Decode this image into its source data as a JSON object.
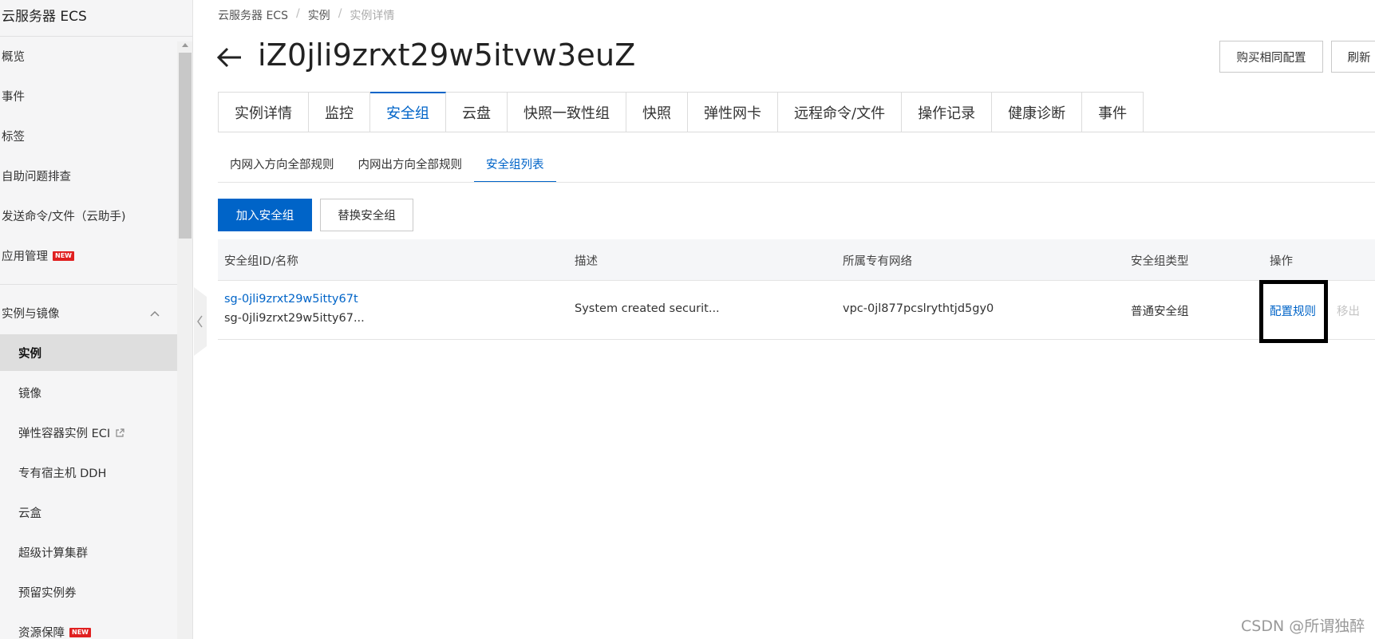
{
  "sidebar": {
    "title": "云服务器 ECS",
    "items": [
      {
        "label": "概览"
      },
      {
        "label": "事件"
      },
      {
        "label": "标签"
      },
      {
        "label": "自助问题排查"
      },
      {
        "label": "发送命令/文件（云助手)"
      },
      {
        "label": "应用管理",
        "badge": "NEW"
      }
    ],
    "group": {
      "label": "实例与镜像",
      "icon": "chevron-up-icon"
    },
    "sub_items": [
      {
        "label": "实例",
        "active": true
      },
      {
        "label": "镜像"
      },
      {
        "label": "弹性容器实例 ECI",
        "icon": "external-link-icon"
      },
      {
        "label": "专有宿主机 DDH"
      },
      {
        "label": "云盒"
      },
      {
        "label": "超级计算集群"
      },
      {
        "label": "预留实例券"
      },
      {
        "label": "资源保障",
        "badge": "NEW"
      }
    ]
  },
  "breadcrumb": [
    "云服务器 ECS",
    "实例",
    "实例详情"
  ],
  "header": {
    "title": "iZ0jli9zrxt29w5itvw3euZ",
    "buy_same_label": "购买相同配置",
    "refresh_label": "刷新"
  },
  "tabs": [
    "实例详情",
    "监控",
    "安全组",
    "云盘",
    "快照一致性组",
    "快照",
    "弹性网卡",
    "远程命令/文件",
    "操作记录",
    "健康诊断",
    "事件"
  ],
  "active_tab": "安全组",
  "subtabs": [
    "内网入方向全部规则",
    "内网出方向全部规则",
    "安全组列表"
  ],
  "active_subtab": "安全组列表",
  "actions": {
    "join_label": "加入安全组",
    "replace_label": "替换安全组"
  },
  "table": {
    "columns": [
      "安全组ID/名称",
      "描述",
      "所属专有网络",
      "安全组类型",
      "操作"
    ],
    "rows": [
      {
        "id": "sg-0jli9zrxt29w5itty67t",
        "name": "sg-0jli9zrxt29w5itty67...",
        "description": "System created securit...",
        "vpc": "vpc-0jl877pcslrythtjd5gy0",
        "type": "普通安全组",
        "op_config": "配置规则",
        "op_remove": "移出"
      }
    ]
  },
  "watermark": "CSDN @所谓独醉",
  "colors": {
    "accent": "#0064c8",
    "badge": "#e02020",
    "highlight": "#000000"
  }
}
